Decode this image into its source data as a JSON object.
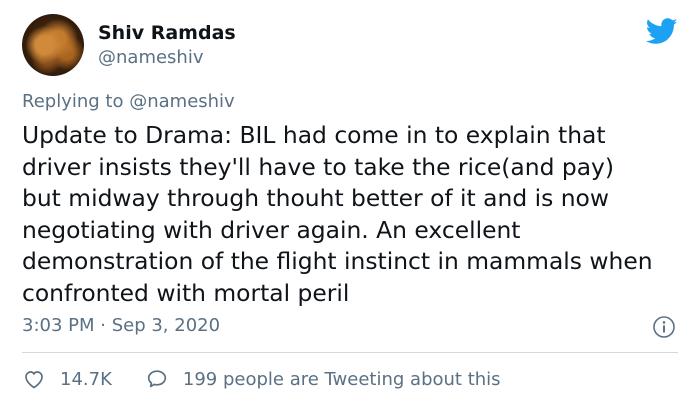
{
  "author": {
    "display_name": "Shiv Ramdas",
    "handle": "@nameshiv",
    "avatar_icon": "profile-avatar"
  },
  "brand": {
    "icon": "twitter-bird-icon",
    "color": "#1da1f2"
  },
  "reply": {
    "prefix": "Replying to",
    "mention": "@nameshiv"
  },
  "tweet": {
    "lines": [
      "Update to Drama: BIL had come in to explain that",
      "driver insists they'll have to take the rice(and pay)",
      "but midway through thouht better of it and is now",
      "negotiating with driver again. An excellent",
      "demonstration of the flight instinct in mammals when",
      "confronted with mortal peril"
    ]
  },
  "meta": {
    "timestamp": "3:03 PM · Sep 3, 2020",
    "info_icon": "info-icon"
  },
  "actions": {
    "likes": "14.7K",
    "like_icon": "heart-icon",
    "conversation": "199 people are Tweeting about this",
    "conversation_icon": "speech-bubble-icon"
  },
  "colors": {
    "text_primary": "#0f1419",
    "text_secondary": "#5b7083",
    "divider": "#cfd9de"
  }
}
